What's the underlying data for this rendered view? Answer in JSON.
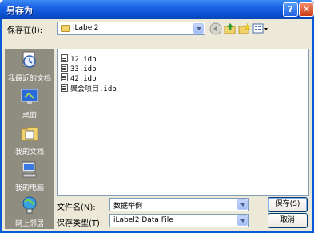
{
  "window": {
    "title": "另存为"
  },
  "titlebar": {
    "help_label": "?",
    "close_label": "✕"
  },
  "location": {
    "label": "保存在(I):",
    "value": "iLabel2"
  },
  "toolbar": {
    "icons": [
      "back-icon",
      "up-folder-icon",
      "new-folder-icon",
      "views-menu-icon"
    ]
  },
  "places": [
    {
      "label": "我最近的文档",
      "icon": "recent-documents-icon"
    },
    {
      "label": "桌面",
      "icon": "desktop-icon"
    },
    {
      "label": "我的文档",
      "icon": "my-documents-icon"
    },
    {
      "label": "我的电脑",
      "icon": "my-computer-icon"
    },
    {
      "label": "网上邻居",
      "icon": "network-places-icon"
    }
  ],
  "files": [
    {
      "name": "12.idb"
    },
    {
      "name": "33.idb"
    },
    {
      "name": "42.idb"
    },
    {
      "name": "聚会项目.idb"
    }
  ],
  "filename": {
    "label": "文件名(N):",
    "value": "数据举例"
  },
  "filetype": {
    "label": "保存类型(T):",
    "value": "iLabel2 Data File"
  },
  "buttons": {
    "save": "保存(S)",
    "cancel": "取消"
  }
}
